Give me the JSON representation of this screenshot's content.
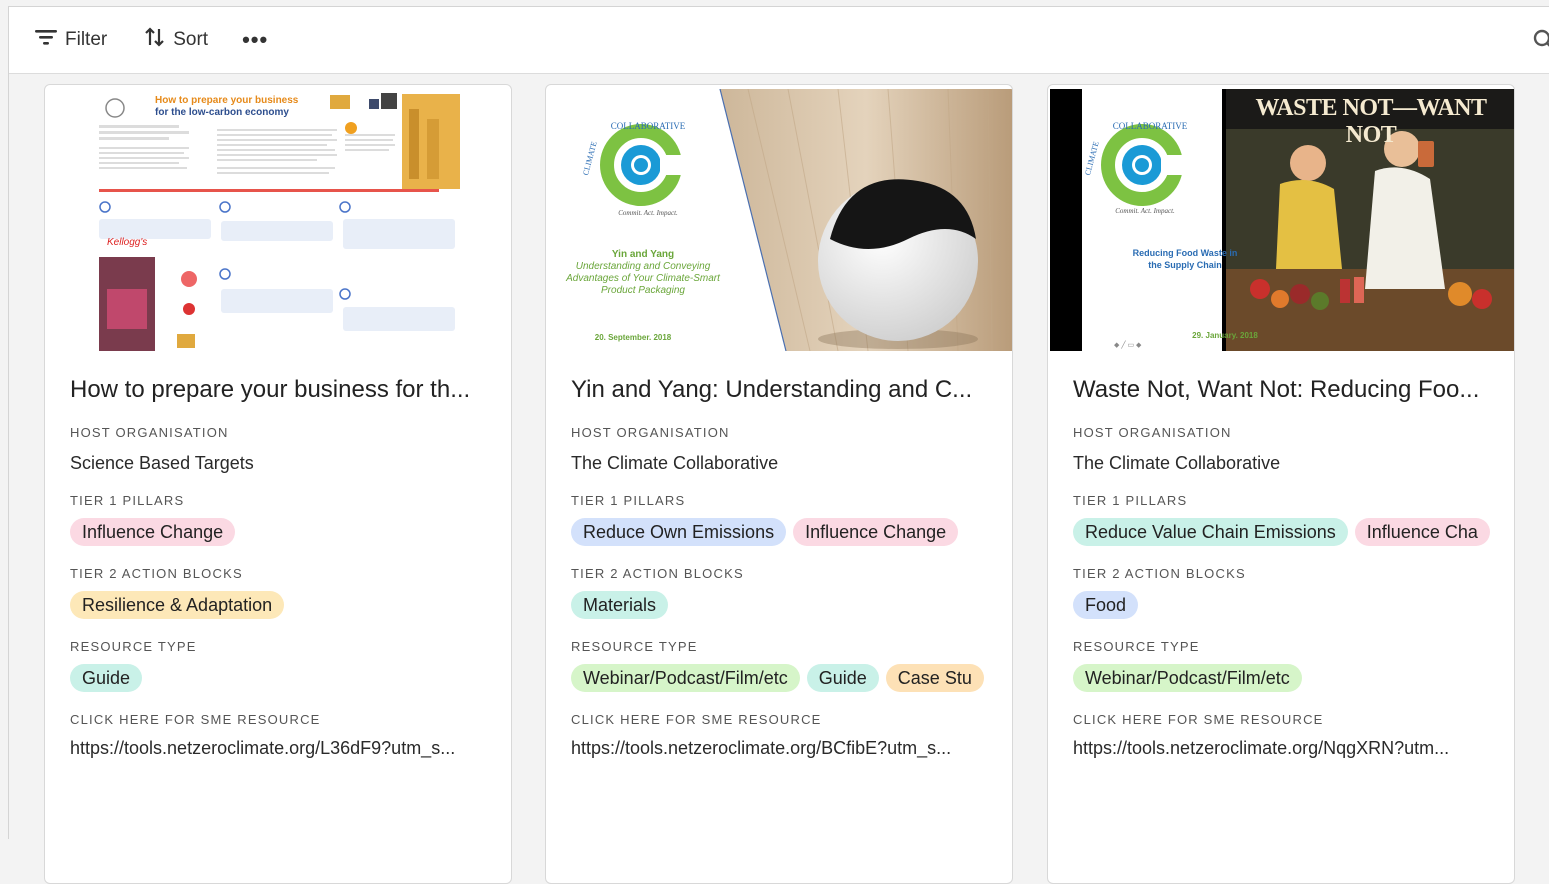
{
  "toolbar": {
    "filter_label": "Filter",
    "sort_label": "Sort",
    "more_label": "•••"
  },
  "labels": {
    "host": "HOST ORGANISATION",
    "tier1": "TIER 1 PILLARS",
    "tier2": "TIER 2 ACTION BLOCKS",
    "resource_type": "RESOURCE TYPE",
    "link": "CLICK HERE FOR SME RESOURCE"
  },
  "colors": {
    "pink": "#fbd9e3",
    "yellow": "#fde8b8",
    "teal": "#c9f1e8",
    "blue": "#d3e1fb",
    "green": "#d6f5c9",
    "orange": "#fde1b6"
  },
  "cards": [
    {
      "title": "How to prepare your business for th...",
      "host": "Science Based Targets",
      "tier1": [
        "Influence Change"
      ],
      "tier2": [
        "Resilience & Adaptation"
      ],
      "resource_type": [
        "Guide"
      ],
      "link": "https://tools.netzeroclimate.org/L36dF9?utm_s...",
      "thumb": {
        "heading": "How to prepare your business for the low-carbon economy",
        "org_lines": [
          "SCIENCE",
          "BASED",
          "TARGETS"
        ]
      }
    },
    {
      "title": "Yin and Yang: Understanding and C...",
      "host": "The Climate Collaborative",
      "tier1": [
        "Reduce Own Emissions",
        "Influence Change"
      ],
      "tier2": [
        "Materials"
      ],
      "resource_type": [
        "Webinar/Podcast/Film/etc",
        "Guide",
        "Case Stu"
      ],
      "link": "https://tools.netzeroclimate.org/BCfibE?utm_s...",
      "thumb": {
        "logo_top": "COLLABORATIVE",
        "logo_side": "CLIMATE",
        "tagline": "Commit. Act. Impact.",
        "heading": "Yin and Yang",
        "subtitle": "Understanding and Conveying Advantages of Your Climate-Smart Product Packaging",
        "date": "20. September. 2018"
      }
    },
    {
      "title": "Waste Not, Want Not: Reducing Foo...",
      "host": "The Climate Collaborative",
      "tier1": [
        "Reduce Value Chain Emissions",
        "Influence Cha"
      ],
      "tier2": [
        "Food"
      ],
      "resource_type": [
        "Webinar/Podcast/Film/etc"
      ],
      "link": "https://tools.netzeroclimate.org/NqgXRN?utm...",
      "thumb": {
        "logo_top": "COLLABORATIVE",
        "logo_side": "CLIMATE",
        "tagline": "Commit. Act. Impact.",
        "heading": "Reducing Food Waste in the Supply Chain",
        "date": "29. January. 2018",
        "poster": "WASTE NOT—WANT NOT"
      }
    }
  ]
}
